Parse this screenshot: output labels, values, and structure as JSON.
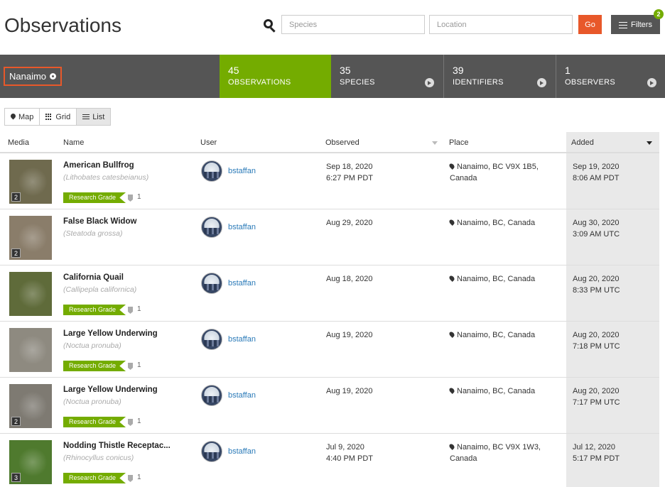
{
  "page": {
    "title": "Observations"
  },
  "search": {
    "species_placeholder": "Species",
    "location_placeholder": "Location",
    "go_label": "Go",
    "filters_label": "Filters",
    "filters_count": "2"
  },
  "place_chip": {
    "label": "Nanaimo"
  },
  "stats": [
    {
      "num": "45",
      "label": "OBSERVATIONS"
    },
    {
      "num": "35",
      "label": "SPECIES"
    },
    {
      "num": "39",
      "label": "IDENTIFIERS"
    },
    {
      "num": "1",
      "label": "OBSERVERS"
    }
  ],
  "views": {
    "map": "Map",
    "grid": "Grid",
    "list": "List",
    "active": "List"
  },
  "columns": {
    "media": "Media",
    "name": "Name",
    "user": "User",
    "observed": "Observed",
    "place": "Place",
    "added": "Added"
  },
  "rows": [
    {
      "photos": "2",
      "common": "American Bullfrog",
      "scientific": "(Lithobates catesbeianus)",
      "grade": "Research Grade",
      "idents": "1",
      "user": "bstaffan",
      "observed": "Sep 18, 2020\n6:27 PM PDT",
      "place": "Nanaimo, BC V9X 1B5, Canada",
      "added": "Sep 19, 2020\n8:06 AM PDT"
    },
    {
      "photos": "2",
      "common": "False Black Widow",
      "scientific": "(Steatoda grossa)",
      "grade": "",
      "idents": "",
      "user": "bstaffan",
      "observed": "Aug 29, 2020",
      "place": "Nanaimo, BC, Canada",
      "added": "Aug 30, 2020\n3:09 AM UTC"
    },
    {
      "photos": "",
      "common": "California Quail",
      "scientific": "(Callipepla californica)",
      "grade": "Research Grade",
      "idents": "1",
      "user": "bstaffan",
      "observed": "Aug 18, 2020",
      "place": "Nanaimo, BC, Canada",
      "added": "Aug 20, 2020\n8:33 PM UTC"
    },
    {
      "photos": "",
      "common": "Large Yellow Underwing",
      "scientific": "(Noctua pronuba)",
      "grade": "Research Grade",
      "idents": "1",
      "user": "bstaffan",
      "observed": "Aug 19, 2020",
      "place": "Nanaimo, BC, Canada",
      "added": "Aug 20, 2020\n7:18 PM UTC"
    },
    {
      "photos": "2",
      "common": "Large Yellow Underwing",
      "scientific": "(Noctua pronuba)",
      "grade": "Research Grade",
      "idents": "1",
      "user": "bstaffan",
      "observed": "Aug 19, 2020",
      "place": "Nanaimo, BC, Canada",
      "added": "Aug 20, 2020\n7:17 PM UTC"
    },
    {
      "photos": "3",
      "common": "Nodding Thistle Receptac...",
      "scientific": "(Rhinocyllus conicus)",
      "grade": "Research Grade",
      "idents": "1",
      "user": "bstaffan",
      "observed": "Jul 9, 2020\n4:40 PM PDT",
      "place": "Nanaimo, BC V9X 1W3,\nCanada",
      "added": "Jul 12, 2020\n5:17 PM PDT"
    }
  ],
  "thumb_colors": [
    "#6f6a4e",
    "#8a7d6a",
    "#5f6b3a",
    "#8e8a80",
    "#7e7a72",
    "#4f7a2e"
  ]
}
